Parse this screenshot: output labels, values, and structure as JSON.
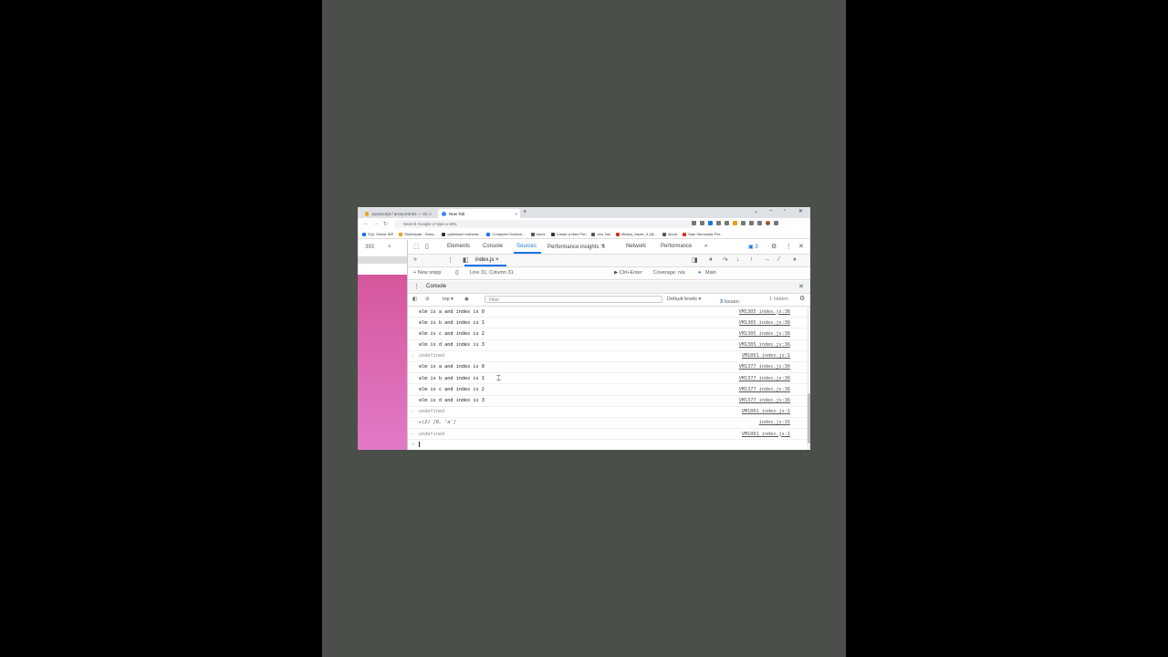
{
  "browser": {
    "tabs": [
      {
        "label": "JavaScript / array.entries — Gr..."
      },
      {
        "label": "New Tab"
      }
    ],
    "new_tab_symbol": "+",
    "window_controls": [
      "⌄",
      "–",
      "▫",
      "✕"
    ],
    "address_placeholder": "Search Google or type a URL",
    "bookmarks": [
      {
        "label": "SQL Online IDE",
        "color": "#1a73e8"
      },
      {
        "label": "Sketchpad - Draw...",
        "color": "#e8a21a"
      },
      {
        "label": "optimized+notheda...",
        "color": "#333333"
      },
      {
        "label": "Computer Science...",
        "color": "#1a73e8"
      },
      {
        "label": "home",
        "color": "#555555"
      },
      {
        "label": "Create a New Pen",
        "color": "#333333"
      },
      {
        "label": "Uxs Tab",
        "color": "#555555"
      },
      {
        "label": "Mickey_frazer_3 (@...",
        "color": "#d93025"
      },
      {
        "label": "about",
        "color": "#555555"
      },
      {
        "label": "Sam Semundar Per...",
        "color": "#d93025"
      }
    ]
  },
  "page": {
    "tab_label": "393",
    "tab_close": "×"
  },
  "devtools": {
    "tabs": [
      "Elements",
      "Console",
      "Sources",
      "Performance insights ⚗",
      "Network",
      "Performance",
      "»"
    ],
    "selected_tab": "Sources",
    "issues_badge": "3",
    "open_file": "index.js",
    "new_snippet": "+ New snipp",
    "cursor_pos": "Line 31, Column 31",
    "run_hint": "▶ Ctrl+Enter",
    "coverage": "Coverage: n/a",
    "thread": "Main",
    "drawer_title": "Console",
    "context": "top ▾",
    "filter_placeholder": "Filter",
    "levels": "Default levels ▾",
    "issues_text": "3 Issues:",
    "issues_count": "3",
    "hidden": "1 hidden"
  },
  "console_lines": [
    {
      "msg": "elm is a and index is 0",
      "src": "VM1305 index.js:36"
    },
    {
      "msg": "elm is b and index is 1",
      "src": "VM1305 index.js:36"
    },
    {
      "msg": "elm is c and index is 2",
      "src": "VM1305 index.js:36"
    },
    {
      "msg": "elm is d and index is 3",
      "src": "VM1305 index.js:36"
    },
    {
      "msg": "undefined",
      "src": "VM1001 index.js:1",
      "result": true
    },
    {
      "msg": "elm is a and index is 0",
      "src": "VM1377 index.js:36"
    },
    {
      "msg": "elm is b and index is 1",
      "src": "VM1377 index.js:36"
    },
    {
      "msg": "elm is c and index is 2",
      "src": "VM1377 index.js:36"
    },
    {
      "msg": "elm is d and index is 3",
      "src": "VM1377 index.js:36"
    },
    {
      "msg": "undefined",
      "src": "VM1001 index.js:1",
      "result": true
    },
    {
      "msg": "▸(2) [0, 'a']",
      "src": "index.js:31",
      "array": true
    },
    {
      "msg": "undefined",
      "src": "VM1001 index.js:1",
      "result": true
    }
  ]
}
